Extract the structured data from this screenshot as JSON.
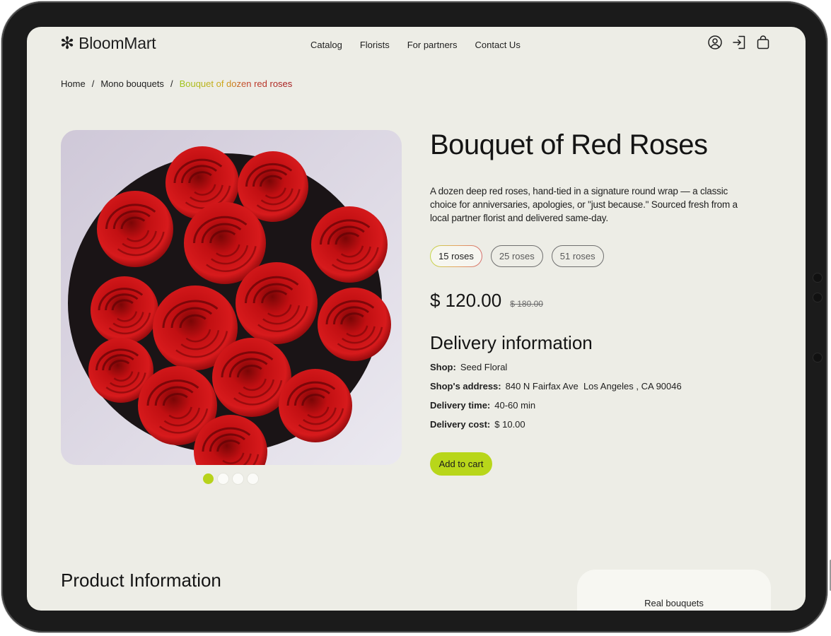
{
  "brand": {
    "name": "BloomMart",
    "mark": "✻"
  },
  "nav": [
    "Catalog",
    "Florists",
    "For partners",
    "Contact Us"
  ],
  "header_icons": [
    "account-icon",
    "login-icon",
    "cart-bag-icon"
  ],
  "breadcrumb": {
    "items": [
      "Home",
      "Mono bouquets"
    ],
    "separator": "/",
    "current": "Bouquet of dozen red roses"
  },
  "product": {
    "title": "Bouquet of Red Roses",
    "description": "A dozen deep red roses, hand-tied in a signature round wrap — a classic choice for anniversaries, apologies, or \"just because.\" Sourced fresh from a local partner florist and delivered same-day.",
    "sizes": [
      "15 roses",
      "25 roses",
      "51 roses"
    ],
    "selected_size": "15 roses",
    "price": "$ 120.00",
    "old_price": "$ 180.00",
    "gallery_count": 4,
    "gallery_active": 1
  },
  "delivery": {
    "heading": "Delivery information",
    "rows": [
      {
        "label": "Shop:",
        "value": "Seed Floral"
      },
      {
        "label": "Shop's address:",
        "value": "840 N Fairfax Ave  Los Angeles , CA 90046"
      },
      {
        "label": "Delivery time:",
        "value": "40-60 min"
      },
      {
        "label": "Delivery cost:",
        "value": "$ 10.00"
      }
    ]
  },
  "actions": {
    "add_to_cart": "Add to cart"
  },
  "product_info": {
    "heading": "Product Information",
    "card_label": "Real bouquets"
  },
  "colors": {
    "accent": "#b8d61a",
    "background": "#edede6",
    "text": "#141414"
  }
}
